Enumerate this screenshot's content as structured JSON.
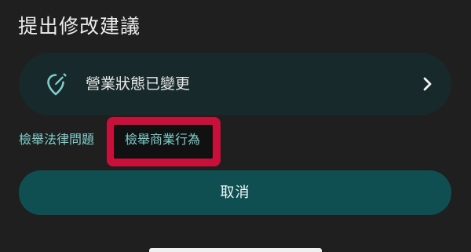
{
  "dialog": {
    "title": "提出修改建議"
  },
  "option": {
    "label": "營業狀態已變更",
    "icon": "edit-location-icon",
    "chevron": "chevron-right-icon"
  },
  "links": {
    "legal": "檢舉法律問題",
    "business": "檢舉商業行為"
  },
  "actions": {
    "cancel": "取消"
  },
  "colors": {
    "background": "#1f1f1f",
    "card": "#17292a",
    "accent": "#7fd0cd",
    "button": "#0f4f52",
    "highlight": "#c8103a"
  }
}
